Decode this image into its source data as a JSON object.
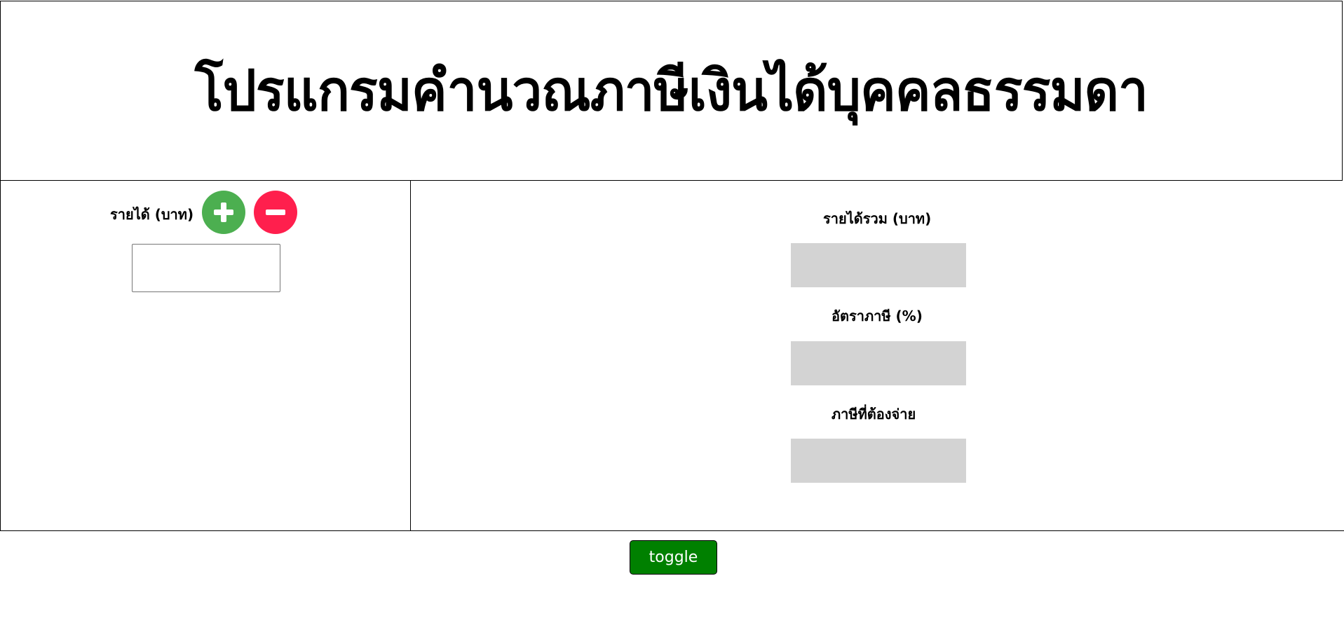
{
  "header": {
    "title": "โปรแกรมคำนวณภาษีเงินได้บุคคลธรรมดา"
  },
  "income": {
    "label": "รายได้ (บาท)",
    "add_icon": "plus-circle-icon",
    "remove_icon": "minus-circle-icon",
    "input_value": "",
    "input_placeholder": ""
  },
  "results": {
    "total_income_label": "รายได้รวม (บาท)",
    "total_income_value": "",
    "tax_rate_label": "อัตราภาษี (%)",
    "tax_rate_value": "",
    "tax_due_label": "ภาษีที่ต้องจ่าย",
    "tax_due_value": ""
  },
  "toggle": {
    "label": "toggle"
  },
  "colors": {
    "add_button": "#4caf50",
    "remove_button": "#ff1f4d",
    "result_box": "#d3d3d3",
    "toggle_button": "#008000"
  }
}
